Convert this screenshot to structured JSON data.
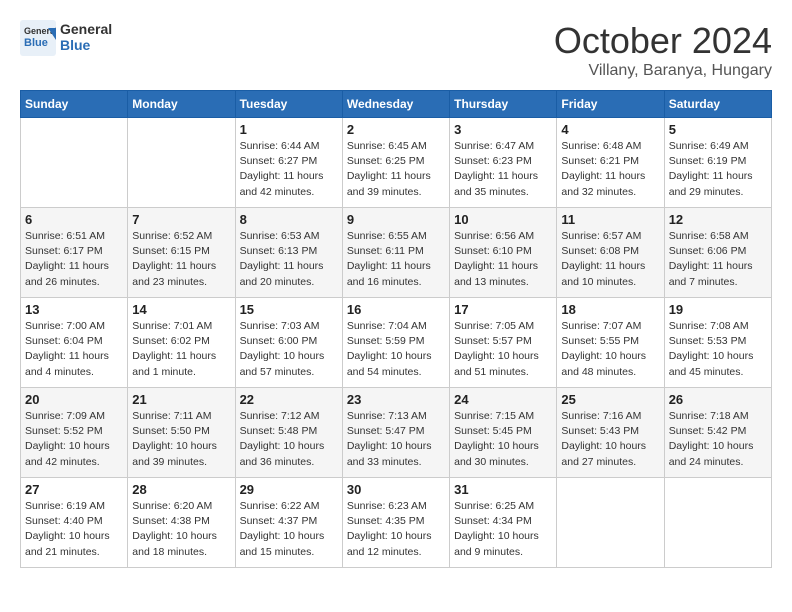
{
  "header": {
    "logo_general": "General",
    "logo_blue": "Blue",
    "month_title": "October 2024",
    "location": "Villany, Baranya, Hungary"
  },
  "columns": [
    "Sunday",
    "Monday",
    "Tuesday",
    "Wednesday",
    "Thursday",
    "Friday",
    "Saturday"
  ],
  "weeks": [
    {
      "days": [
        {
          "num": "",
          "info": ""
        },
        {
          "num": "",
          "info": ""
        },
        {
          "num": "1",
          "info": "Sunrise: 6:44 AM\nSunset: 6:27 PM\nDaylight: 11 hours and 42 minutes."
        },
        {
          "num": "2",
          "info": "Sunrise: 6:45 AM\nSunset: 6:25 PM\nDaylight: 11 hours and 39 minutes."
        },
        {
          "num": "3",
          "info": "Sunrise: 6:47 AM\nSunset: 6:23 PM\nDaylight: 11 hours and 35 minutes."
        },
        {
          "num": "4",
          "info": "Sunrise: 6:48 AM\nSunset: 6:21 PM\nDaylight: 11 hours and 32 minutes."
        },
        {
          "num": "5",
          "info": "Sunrise: 6:49 AM\nSunset: 6:19 PM\nDaylight: 11 hours and 29 minutes."
        }
      ]
    },
    {
      "days": [
        {
          "num": "6",
          "info": "Sunrise: 6:51 AM\nSunset: 6:17 PM\nDaylight: 11 hours and 26 minutes."
        },
        {
          "num": "7",
          "info": "Sunrise: 6:52 AM\nSunset: 6:15 PM\nDaylight: 11 hours and 23 minutes."
        },
        {
          "num": "8",
          "info": "Sunrise: 6:53 AM\nSunset: 6:13 PM\nDaylight: 11 hours and 20 minutes."
        },
        {
          "num": "9",
          "info": "Sunrise: 6:55 AM\nSunset: 6:11 PM\nDaylight: 11 hours and 16 minutes."
        },
        {
          "num": "10",
          "info": "Sunrise: 6:56 AM\nSunset: 6:10 PM\nDaylight: 11 hours and 13 minutes."
        },
        {
          "num": "11",
          "info": "Sunrise: 6:57 AM\nSunset: 6:08 PM\nDaylight: 11 hours and 10 minutes."
        },
        {
          "num": "12",
          "info": "Sunrise: 6:58 AM\nSunset: 6:06 PM\nDaylight: 11 hours and 7 minutes."
        }
      ]
    },
    {
      "days": [
        {
          "num": "13",
          "info": "Sunrise: 7:00 AM\nSunset: 6:04 PM\nDaylight: 11 hours and 4 minutes."
        },
        {
          "num": "14",
          "info": "Sunrise: 7:01 AM\nSunset: 6:02 PM\nDaylight: 11 hours and 1 minute."
        },
        {
          "num": "15",
          "info": "Sunrise: 7:03 AM\nSunset: 6:00 PM\nDaylight: 10 hours and 57 minutes."
        },
        {
          "num": "16",
          "info": "Sunrise: 7:04 AM\nSunset: 5:59 PM\nDaylight: 10 hours and 54 minutes."
        },
        {
          "num": "17",
          "info": "Sunrise: 7:05 AM\nSunset: 5:57 PM\nDaylight: 10 hours and 51 minutes."
        },
        {
          "num": "18",
          "info": "Sunrise: 7:07 AM\nSunset: 5:55 PM\nDaylight: 10 hours and 48 minutes."
        },
        {
          "num": "19",
          "info": "Sunrise: 7:08 AM\nSunset: 5:53 PM\nDaylight: 10 hours and 45 minutes."
        }
      ]
    },
    {
      "days": [
        {
          "num": "20",
          "info": "Sunrise: 7:09 AM\nSunset: 5:52 PM\nDaylight: 10 hours and 42 minutes."
        },
        {
          "num": "21",
          "info": "Sunrise: 7:11 AM\nSunset: 5:50 PM\nDaylight: 10 hours and 39 minutes."
        },
        {
          "num": "22",
          "info": "Sunrise: 7:12 AM\nSunset: 5:48 PM\nDaylight: 10 hours and 36 minutes."
        },
        {
          "num": "23",
          "info": "Sunrise: 7:13 AM\nSunset: 5:47 PM\nDaylight: 10 hours and 33 minutes."
        },
        {
          "num": "24",
          "info": "Sunrise: 7:15 AM\nSunset: 5:45 PM\nDaylight: 10 hours and 30 minutes."
        },
        {
          "num": "25",
          "info": "Sunrise: 7:16 AM\nSunset: 5:43 PM\nDaylight: 10 hours and 27 minutes."
        },
        {
          "num": "26",
          "info": "Sunrise: 7:18 AM\nSunset: 5:42 PM\nDaylight: 10 hours and 24 minutes."
        }
      ]
    },
    {
      "days": [
        {
          "num": "27",
          "info": "Sunrise: 6:19 AM\nSunset: 4:40 PM\nDaylight: 10 hours and 21 minutes."
        },
        {
          "num": "28",
          "info": "Sunrise: 6:20 AM\nSunset: 4:38 PM\nDaylight: 10 hours and 18 minutes."
        },
        {
          "num": "29",
          "info": "Sunrise: 6:22 AM\nSunset: 4:37 PM\nDaylight: 10 hours and 15 minutes."
        },
        {
          "num": "30",
          "info": "Sunrise: 6:23 AM\nSunset: 4:35 PM\nDaylight: 10 hours and 12 minutes."
        },
        {
          "num": "31",
          "info": "Sunrise: 6:25 AM\nSunset: 4:34 PM\nDaylight: 10 hours and 9 minutes."
        },
        {
          "num": "",
          "info": ""
        },
        {
          "num": "",
          "info": ""
        }
      ]
    }
  ]
}
